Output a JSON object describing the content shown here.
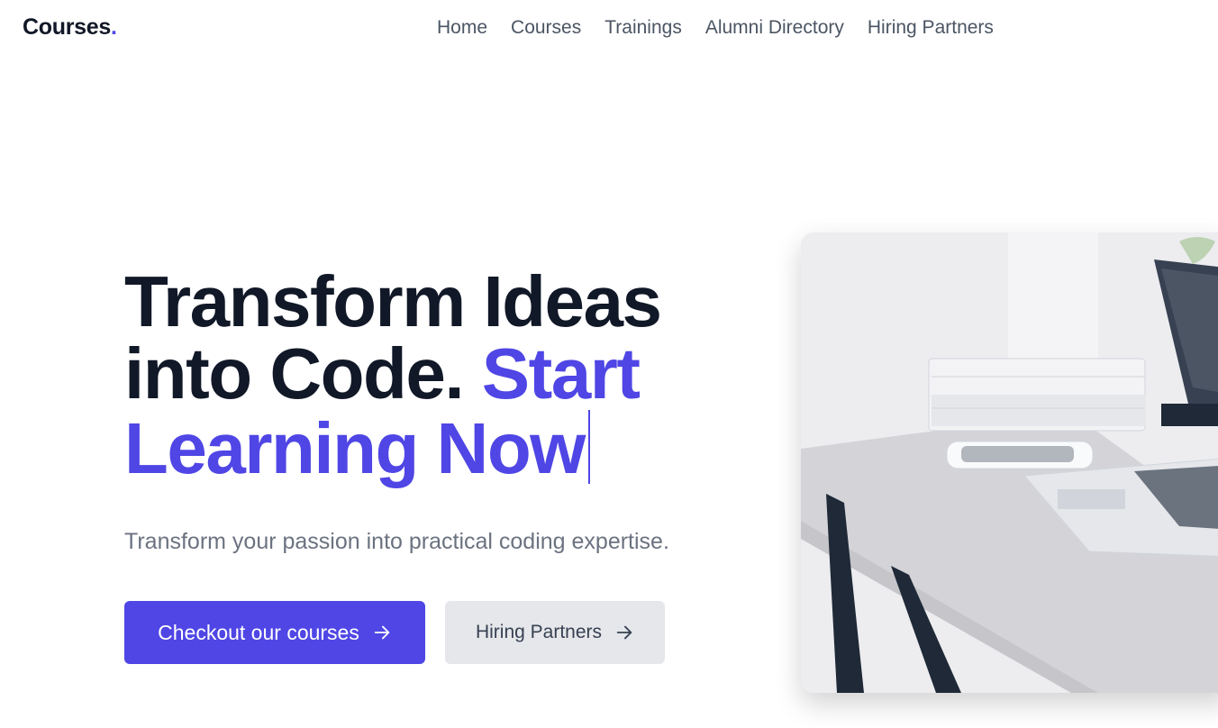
{
  "brand": {
    "name": "Courses",
    "dot": ".",
    "accent_color": "#4f46e5"
  },
  "nav": {
    "items": [
      {
        "label": "Home"
      },
      {
        "label": "Courses"
      },
      {
        "label": "Trainings"
      },
      {
        "label": "Alumni Directory"
      },
      {
        "label": "Hiring Partners"
      }
    ]
  },
  "hero": {
    "title_line1": "Transform Ideas",
    "title_line2": "into Code.",
    "title_accent1": "Start",
    "title_accent2": "Learning Now",
    "subtitle": "Transform your passion into practical coding expertise.",
    "primary_button": {
      "label": "Checkout our courses",
      "icon": "arrow-right-icon"
    },
    "secondary_button": {
      "label": "Hiring Partners",
      "icon": "arrow-right-icon"
    }
  },
  "image": {
    "subject": "laptop-on-desk-photo"
  },
  "colors": {
    "primary": "#4f46e5",
    "text_dark": "#111827",
    "text_muted": "#6b7280",
    "secondary_bg": "#e5e7eb"
  }
}
